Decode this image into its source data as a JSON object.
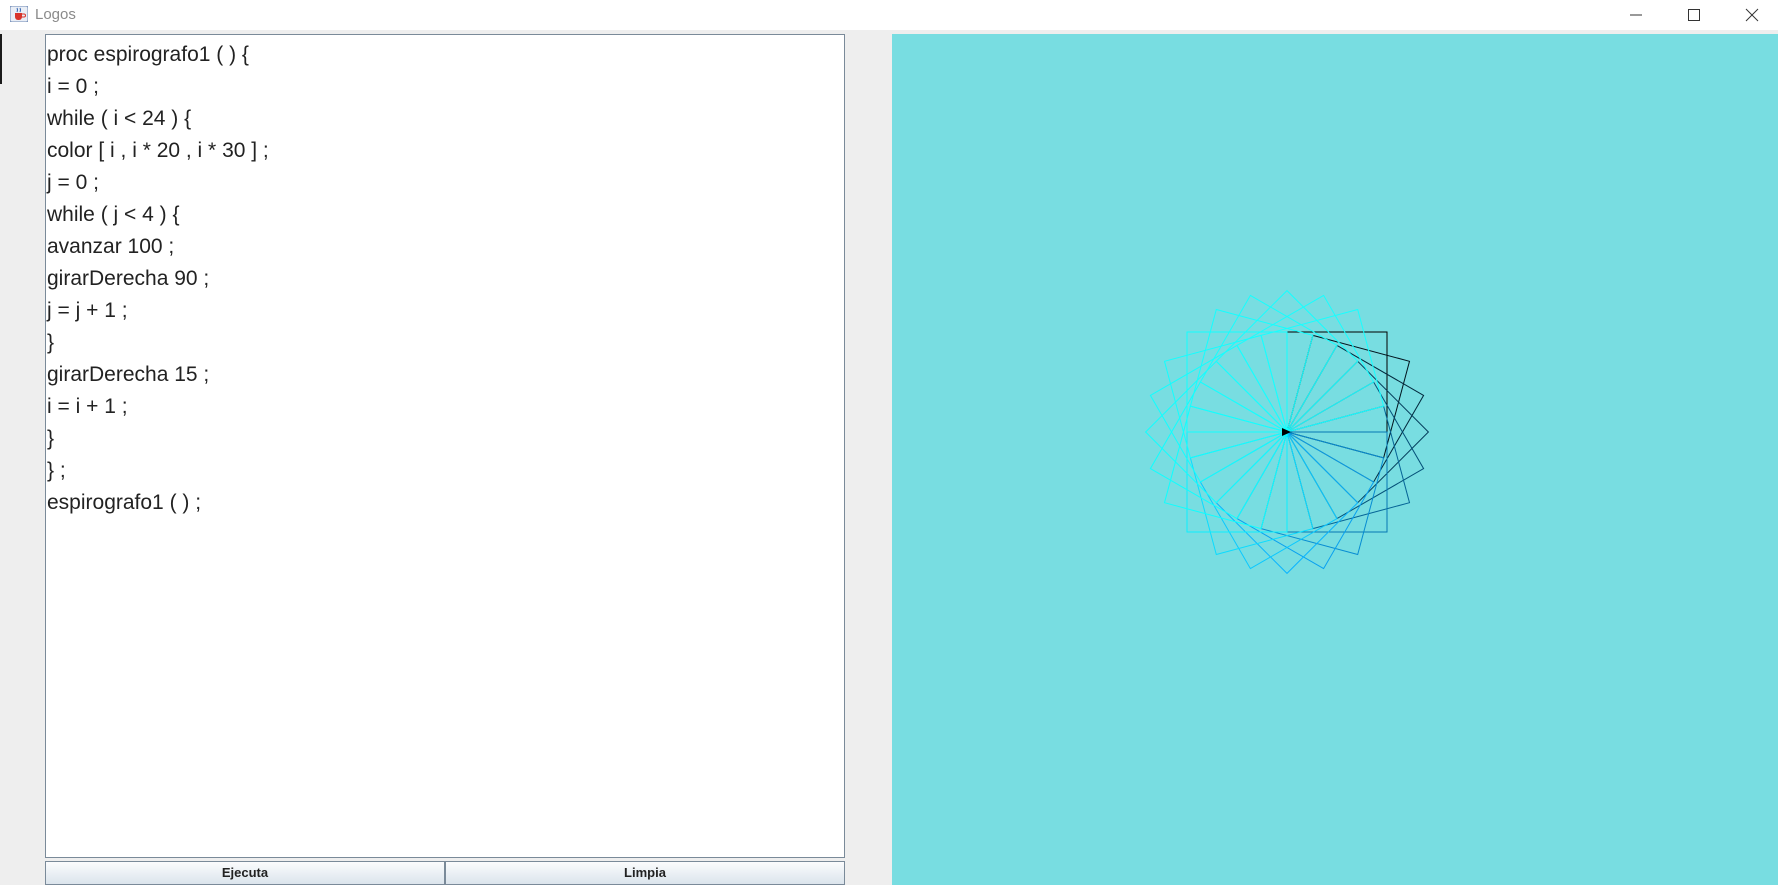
{
  "window": {
    "title": "Logos",
    "icon": "java-cup-icon",
    "controls": [
      "minimize-icon",
      "maximize-icon",
      "close-icon"
    ]
  },
  "editor": {
    "lines": [
      "proc espirografo1 ( ) {",
      "i = 0 ;",
      "while ( i < 24 ) {",
      "color [ i , i * 20 , i * 30 ] ;",
      "j = 0 ;",
      "while ( j < 4 ) {",
      "avanzar 100 ;",
      "girarDerecha 90 ;",
      "j = j + 1 ;",
      "}",
      "girarDerecha 15 ;",
      "i = i + 1 ;",
      "}",
      "} ;",
      "espirografo1 ( ) ;"
    ]
  },
  "buttons": {
    "ejecuta": "Ejecuta",
    "limpia": "Limpia"
  },
  "canvas": {
    "background": "#78dde1",
    "turtle_color": "#000000",
    "program": {
      "iterations": 24,
      "side": 100,
      "inner_turn_deg": 90,
      "outer_turn_deg": 15
    }
  }
}
